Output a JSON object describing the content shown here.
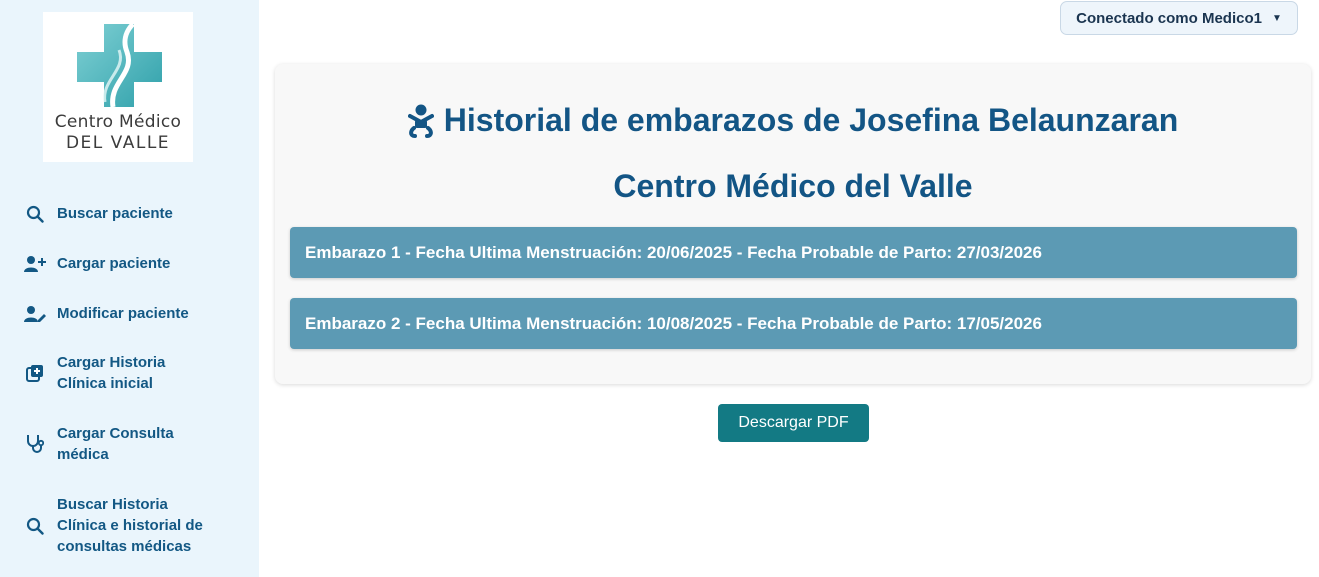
{
  "brand": {
    "line1": "Centro Médico",
    "line2": "del Valle"
  },
  "header": {
    "user_label": "Conectado como Medico1",
    "caret": "▼"
  },
  "sidebar": {
    "items": [
      {
        "label": "Buscar paciente",
        "icon": "search-icon"
      },
      {
        "label": "Cargar paciente",
        "icon": "user-plus-icon"
      },
      {
        "label": "Modificar paciente",
        "icon": "user-edit-icon"
      },
      {
        "label": "Cargar Historia Clínica inicial",
        "icon": "file-medical-plus-icon"
      },
      {
        "label": "Cargar Consulta médica",
        "icon": "stethoscope-icon"
      },
      {
        "label": "Buscar Historia Clínica e historial de consultas médicas",
        "icon": "search-icon"
      }
    ]
  },
  "main": {
    "title": "Historial de embarazos de Josefina Belaunzaran",
    "subtitle": "Centro Médico del Valle",
    "pregnancies": [
      {
        "label": "Embarazo 1 - Fecha Ultima Menstruación: 20/06/2025 - Fecha Probable de Parto: 27/03/2026"
      },
      {
        "label": "Embarazo 2 - Fecha Ultima Menstruación: 10/08/2025 - Fecha Probable de Parto: 17/05/2026"
      }
    ],
    "download_label": "Descargar PDF"
  },
  "colors": {
    "sidebar_bg": "#eaf5fc",
    "nav_text": "#135884",
    "title": "#135585",
    "accordion": "#5c9ab4",
    "button": "#137a84"
  }
}
